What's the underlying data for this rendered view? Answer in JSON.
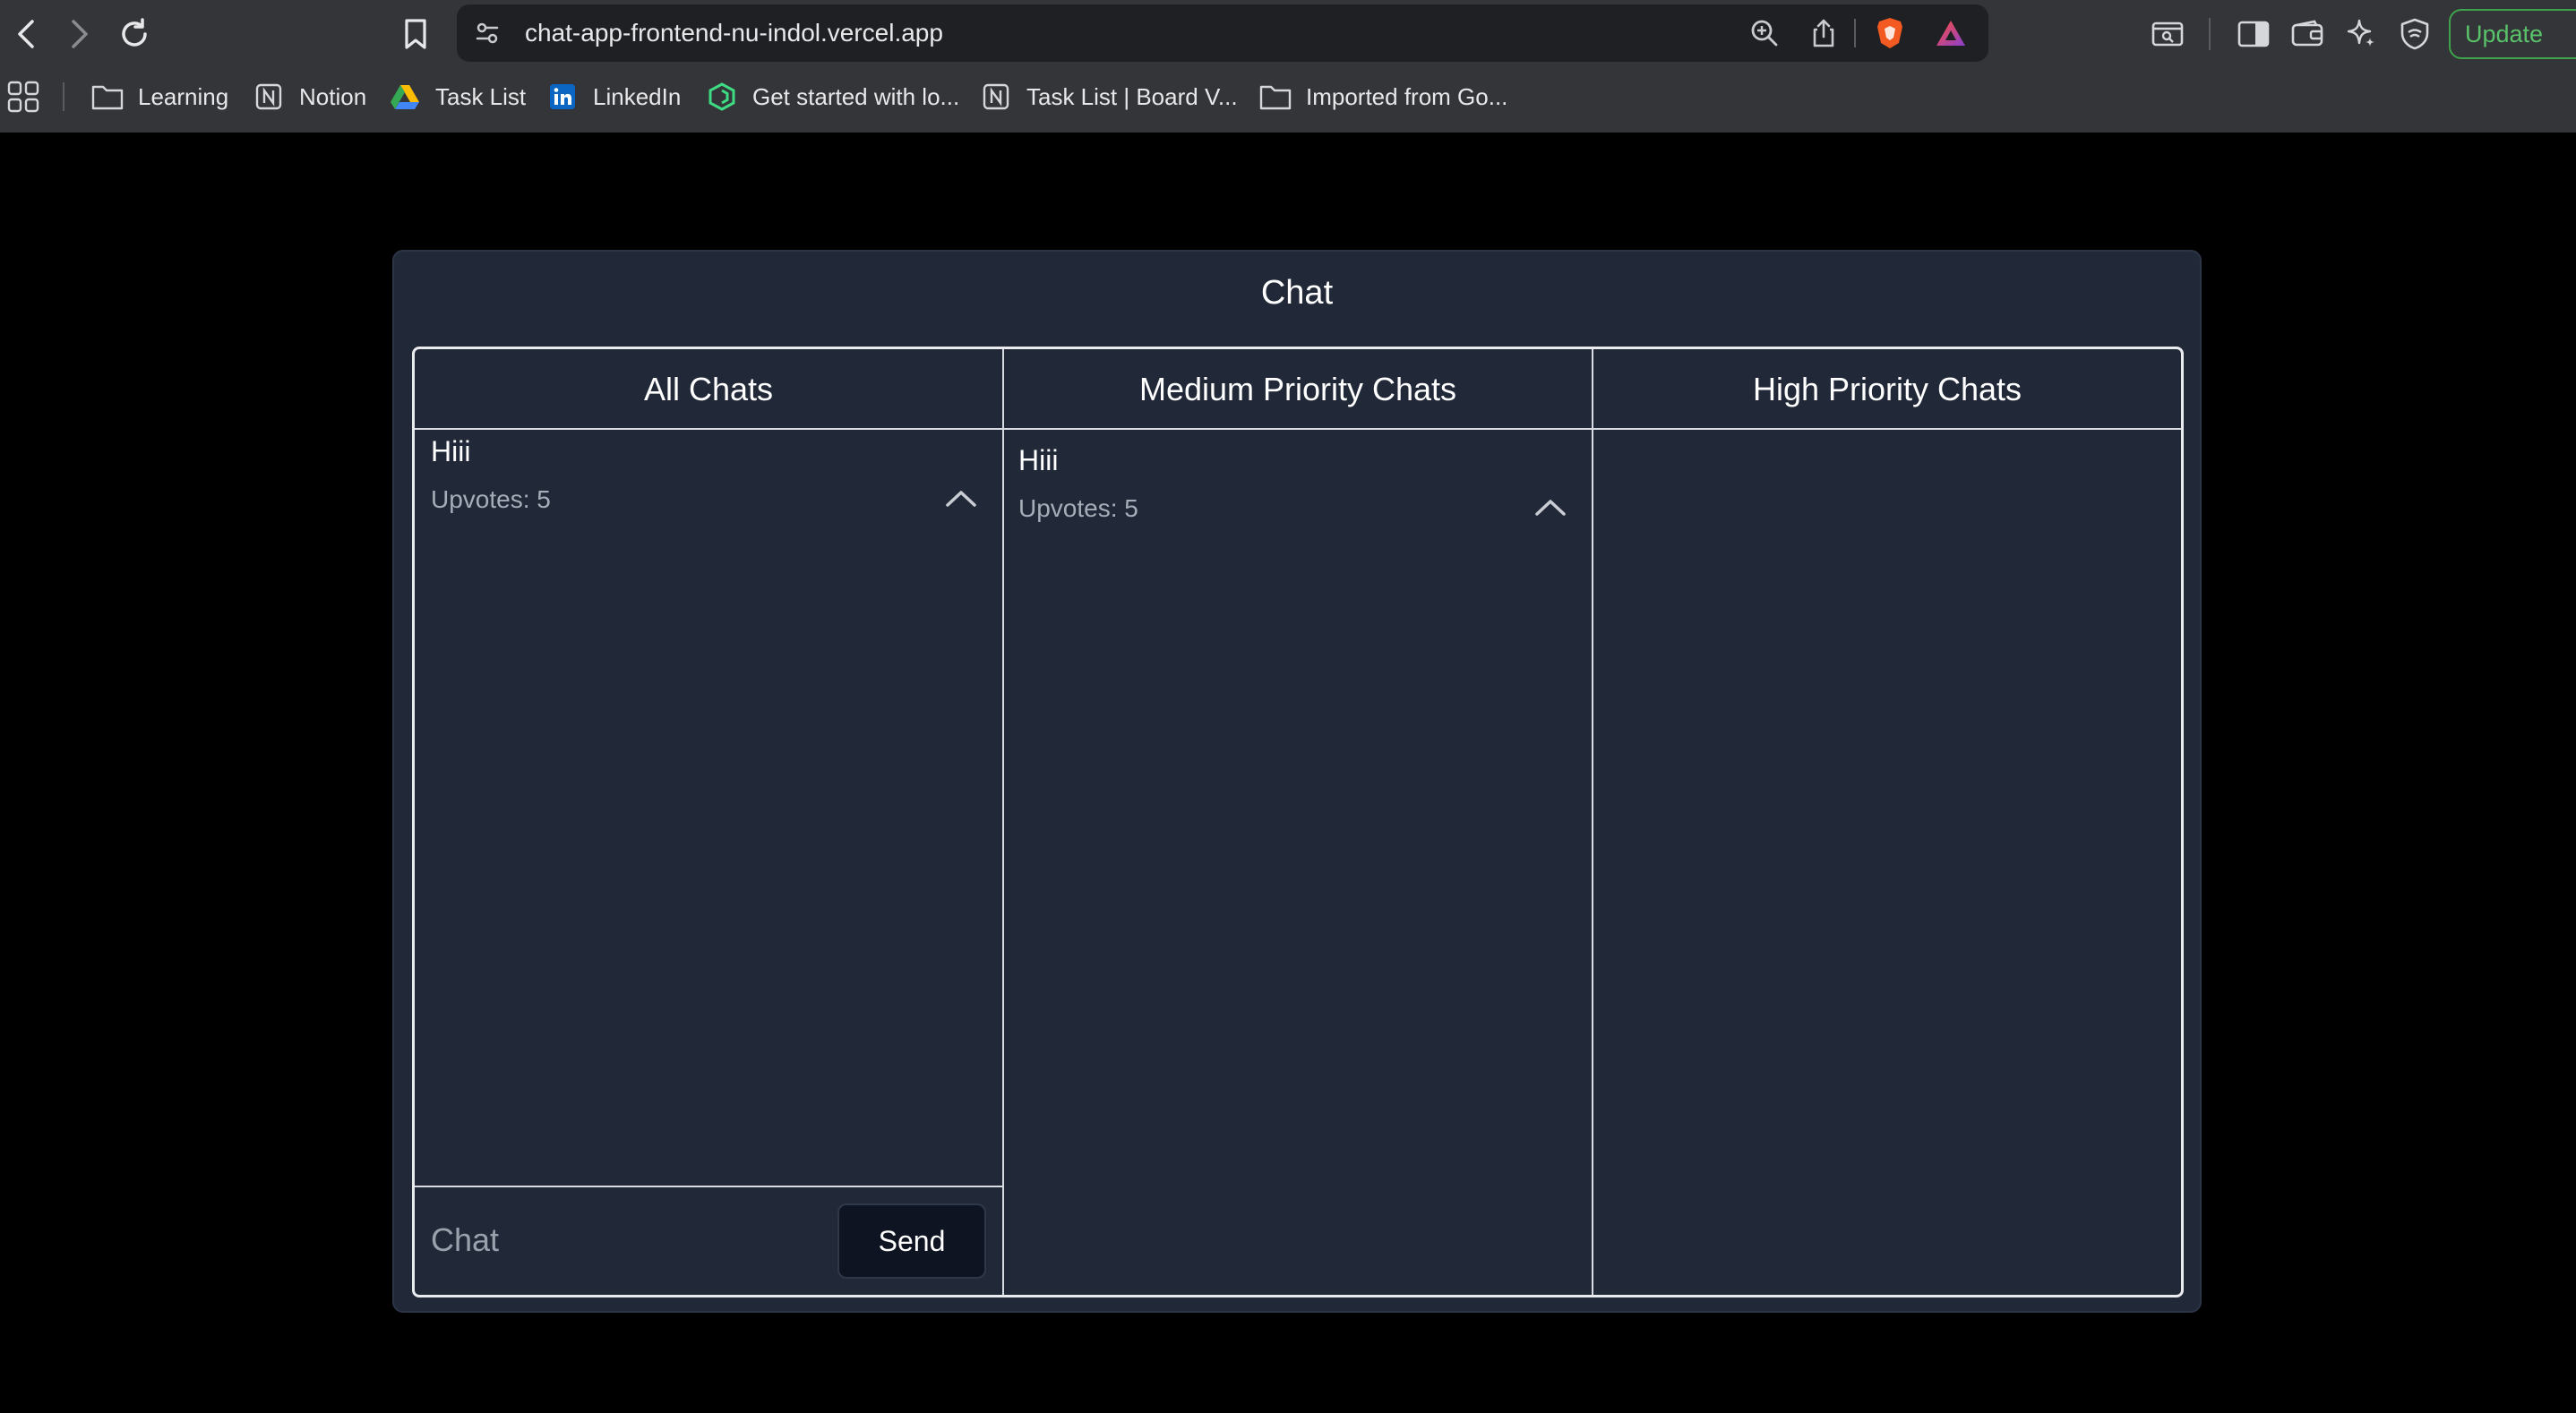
{
  "browser": {
    "url": "chat-app-frontend-nu-indol.vercel.app",
    "update_label": "Update",
    "accent_colors": {
      "update": "#59c26a",
      "brave": "#f25a22",
      "rewards": "#8b3fd1"
    },
    "bookmarks": [
      {
        "label": "Learning",
        "icon": "folder-icon"
      },
      {
        "label": "Notion",
        "icon": "notion-icon"
      },
      {
        "label": "Task List",
        "icon": "google-drive-icon"
      },
      {
        "label": "LinkedIn",
        "icon": "linkedin-icon"
      },
      {
        "label": "Get started with lo...",
        "icon": "green-hex-icon"
      },
      {
        "label": "Task List | Board V...",
        "icon": "notion-icon"
      },
      {
        "label": "Imported from Go...",
        "icon": "folder-icon"
      }
    ]
  },
  "app": {
    "title": "Chat",
    "columns": [
      {
        "title": "All Chats",
        "chats": [
          {
            "text": "Hiii",
            "upvotes": "Upvotes: 5"
          }
        ]
      },
      {
        "title": "Medium Priority Chats",
        "chats": [
          {
            "text": "Hiii",
            "upvotes": "Upvotes: 5"
          }
        ]
      },
      {
        "title": "High Priority Chats",
        "chats": []
      }
    ],
    "composer": {
      "placeholder": "Chat",
      "value": "",
      "send_label": "Send"
    }
  }
}
